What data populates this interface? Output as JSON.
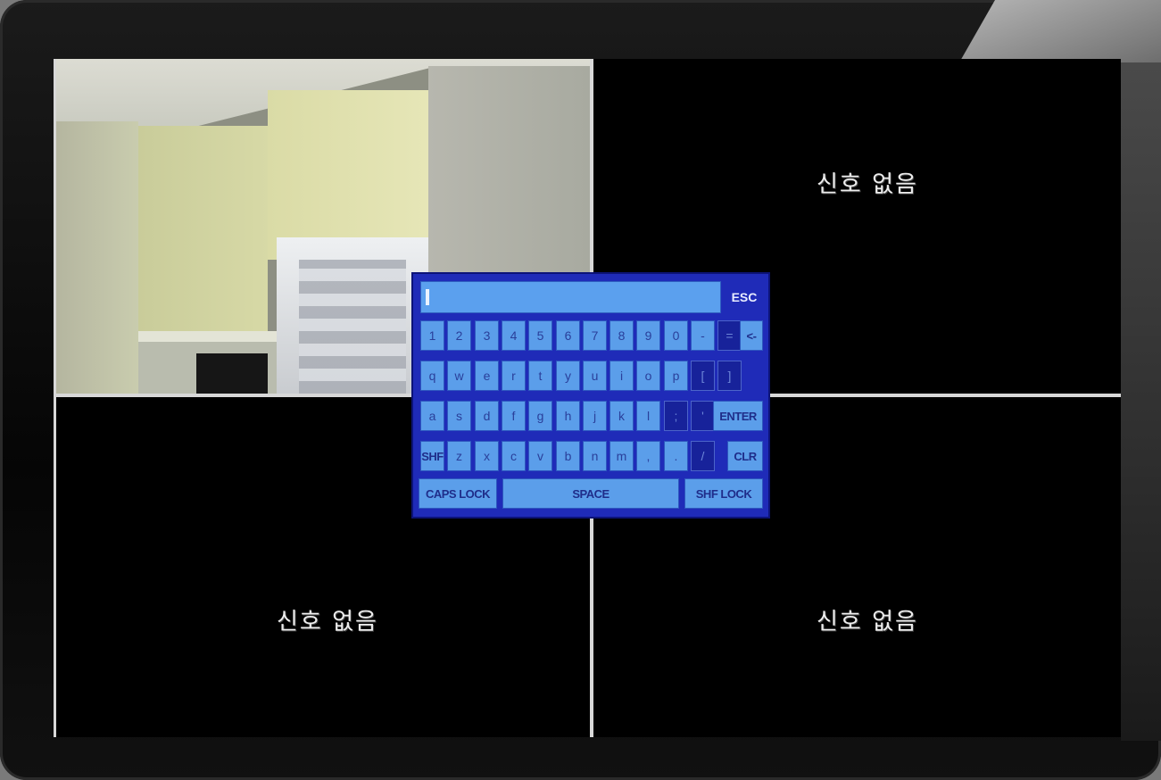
{
  "screen": {
    "no_signal_text": "신호 없음"
  },
  "keyboard": {
    "input_value": "",
    "esc_label": "ESC",
    "row1": [
      "1",
      "2",
      "3",
      "4",
      "5",
      "6",
      "7",
      "8",
      "9",
      "0",
      "-",
      "=",
      "<-"
    ],
    "row2": [
      "q",
      "w",
      "e",
      "r",
      "t",
      "y",
      "u",
      "i",
      "o",
      "p",
      "[",
      "]"
    ],
    "row3": [
      "a",
      "s",
      "d",
      "f",
      "g",
      "h",
      "j",
      "k",
      "l",
      ";",
      "'",
      "ENTER"
    ],
    "row4": [
      "SHF",
      "z",
      "x",
      "c",
      "v",
      "b",
      "n",
      "m",
      ",",
      ".",
      "/",
      "CLR"
    ],
    "row5": [
      "CAPS LOCK",
      "SPACE",
      "SHF LOCK"
    ]
  },
  "colors": {
    "keyboard_bg": "#1f2bb8",
    "key_bg": "#5b9eea",
    "divider": "#d8d8d8"
  }
}
